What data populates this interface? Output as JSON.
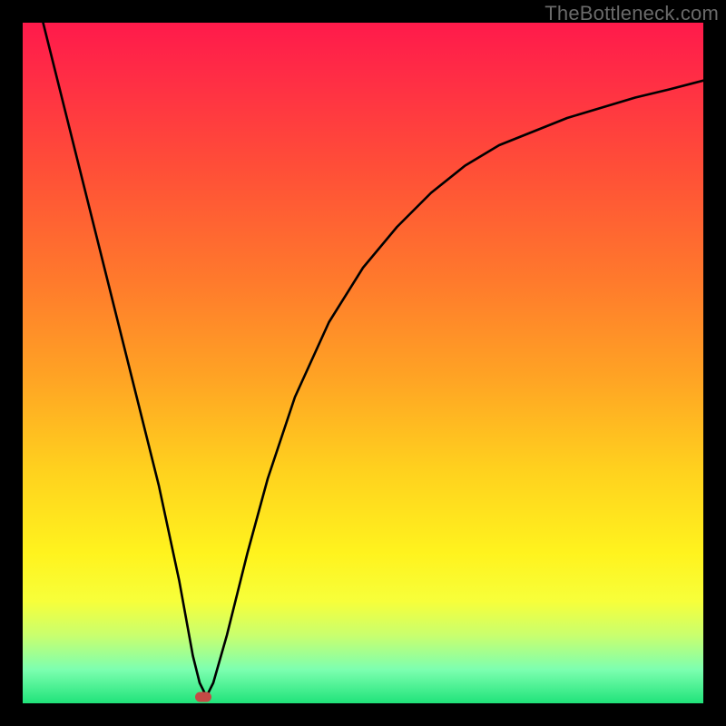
{
  "attribution": "TheBottleneck.com",
  "chart_data": {
    "type": "line",
    "title": "",
    "xlabel": "",
    "ylabel": "",
    "xlim": [
      0,
      100
    ],
    "ylim": [
      0,
      100
    ],
    "grid": false,
    "legend": false,
    "background": "gradient-red-to-green",
    "series": [
      {
        "name": "bottleneck-curve",
        "x": [
          3,
          5,
          8,
          12,
          16,
          20,
          23,
          25,
          26,
          27,
          28,
          30,
          33,
          36,
          40,
          45,
          50,
          55,
          60,
          65,
          70,
          75,
          80,
          85,
          90,
          95,
          100
        ],
        "y": [
          100,
          92,
          80,
          64,
          48,
          32,
          18,
          7,
          3,
          1,
          3,
          10,
          22,
          33,
          45,
          56,
          64,
          70,
          75,
          79,
          82,
          84,
          86,
          87.5,
          89,
          90.2,
          91.5
        ]
      }
    ],
    "marker": {
      "x": 26.5,
      "y": 1,
      "color": "#c44a45"
    }
  }
}
